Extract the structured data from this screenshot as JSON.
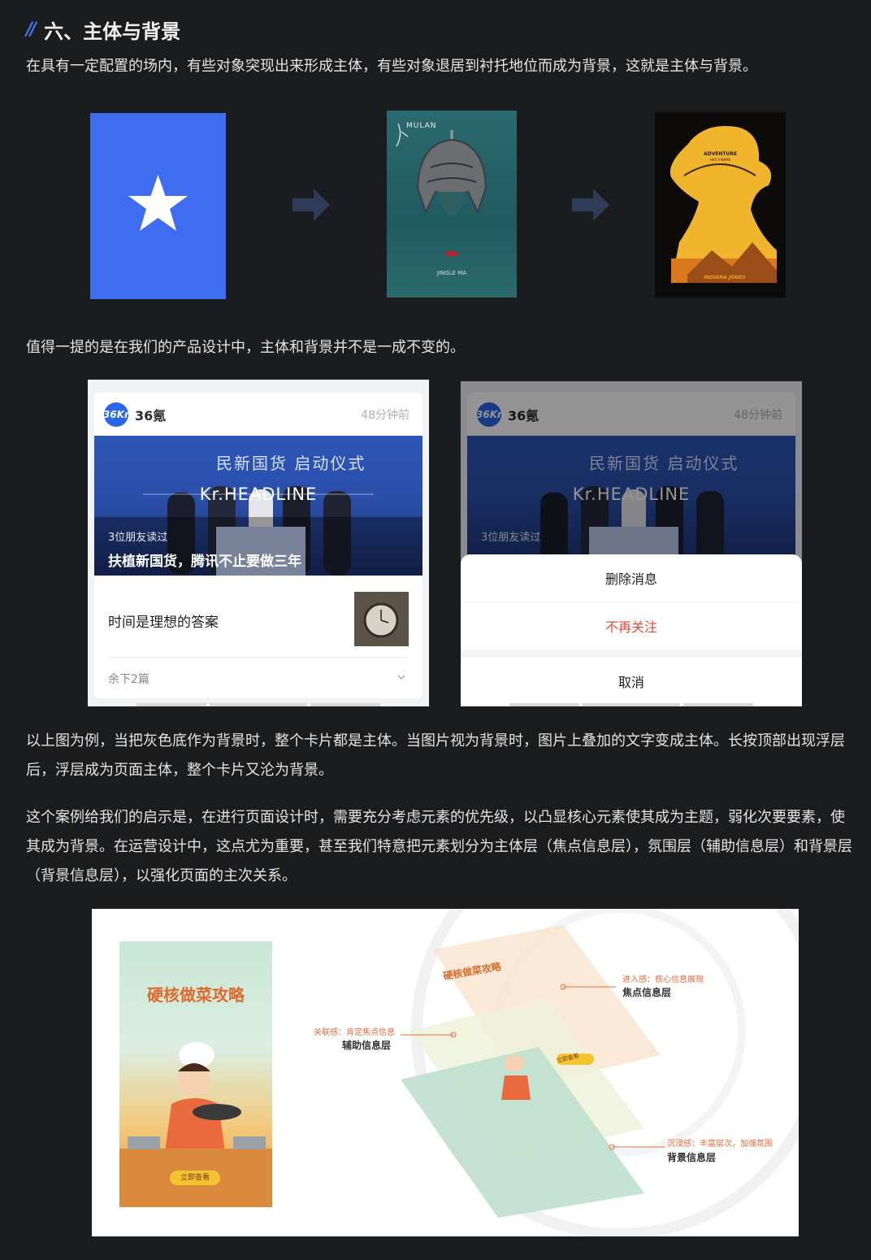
{
  "section": {
    "heading_marker": "//",
    "heading": "六、主体与背景",
    "intro": "在具有一定配置的场内，有些对象突现出来形成主体，有些对象退居到衬托地位而成为背景，这就是主体与背景。",
    "note": "值得一提的是在我们的产品设计中，主体和背景并不是一成不变的。",
    "explain": "以上图为例，当把灰色底作为背景时，整个卡片都是主体。当图片视为背景时，图片上叠加的文字变成主体。长按顶部出现浮层后，浮层成为页面主体，整个卡片又沦为背景。",
    "insight": "这个案例给我们的启示是，在进行页面设计时，需要充分考虑元素的优先级，以凸显核心元素使其成为主题，弱化次要要素，使其成为背景。在运营设计中，这点尤为重要，甚至我们特意把元素划分为主体层（焦点信息层），氛围层（辅助信息层）和背景层（背景信息层），以强化页面的主次关系。"
  },
  "posters": {
    "mulan_title": "MULAN",
    "mulan_name": "JINGLE MA",
    "adventure": "ADVENTURE",
    "adventure_sub": "HAS A NAME",
    "indiana": "INDIANA JONES"
  },
  "feed_card": {
    "logo_text": "36Kr",
    "source": "36氪",
    "time": "48分钟前",
    "headline_overlay": "Kr.HEADLINE",
    "banner_text": "民新国货 启动仪式",
    "friends_read": "3位朋友读过",
    "hero_title": "扶植新国货，腾讯不止要做三年",
    "item_title": "时间是理想的答案",
    "remaining": "余下2篇"
  },
  "action_sheet": {
    "delete": "删除消息",
    "unfollow": "不再关注",
    "cancel": "取消"
  },
  "illustration": {
    "poster_title": "硬核做菜攻略",
    "poster_button": "立即查看",
    "layer_title_small": "硬核做菜攻略",
    "layer_button_small": "立即查看",
    "focus_desc": "进入感：核心信息展现",
    "focus_name": "焦点信息层",
    "aux_desc": "关联感：肯定焦点信息",
    "aux_name": "辅助信息层",
    "bg_desc": "沉浸感：丰富层次，加强氛围",
    "bg_name": "背景信息层"
  },
  "colors": {
    "page_bg": "#1b1c1e",
    "accent": "#3f74f2",
    "unfollow_red": "#e0483e"
  }
}
